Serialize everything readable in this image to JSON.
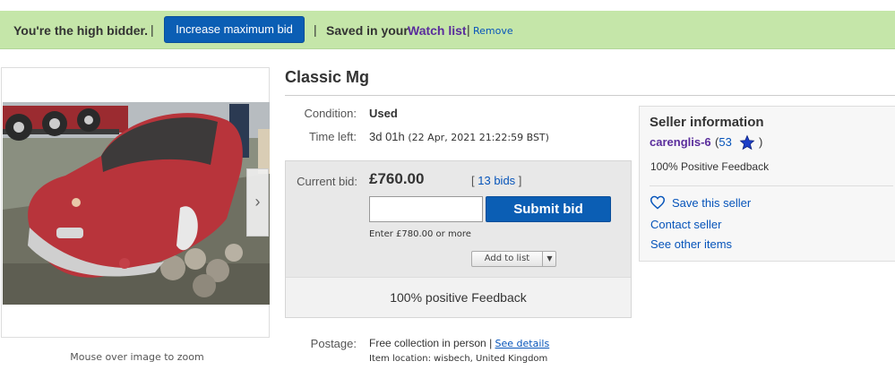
{
  "banner": {
    "high_bidder": "You're the high bidder.",
    "sep": "|",
    "increase_button": "Increase maximum bid",
    "saved_prefix": "Saved in your",
    "watch_list": "Watch list",
    "remove": "Remove",
    "bg_color": "#c5e6a9"
  },
  "gallery": {
    "zoom_note": "Mouse over image to zoom",
    "next_icon": "chevron-right-icon"
  },
  "item": {
    "title": "Classic Mg",
    "condition_label": "Condition:",
    "condition_value": "Used",
    "time_left_label": "Time left:",
    "time_left_value": "3d 01h",
    "time_left_date": "(22 Apr, 2021  21:22:59 BST)"
  },
  "bid": {
    "current_label": "Current bid:",
    "price": "£760.00",
    "bids_open": "[",
    "bids_count": "13 bids",
    "bids_close": "]",
    "input_value": "",
    "submit_label": "Submit bid",
    "enter_hint": "Enter £780.00 or more",
    "add_to_list": "Add to list",
    "feedback_strip": "100% positive Feedback",
    "button_color": "#0b5eb4"
  },
  "postage": {
    "label": "Postage:",
    "value": "Free collection in person |",
    "see_details": "See details",
    "item_location": "Item location: wisbech, United Kingdom"
  },
  "seller": {
    "heading": "Seller information",
    "name": "carenglis-6",
    "score_open": "(",
    "score": "53",
    "score_close": ")",
    "positive": "100% Positive Feedback",
    "save_seller": "Save this seller",
    "contact": "Contact seller",
    "other_items": "See other items",
    "link_color": "#0654ba",
    "name_color": "#5a2d9c"
  }
}
